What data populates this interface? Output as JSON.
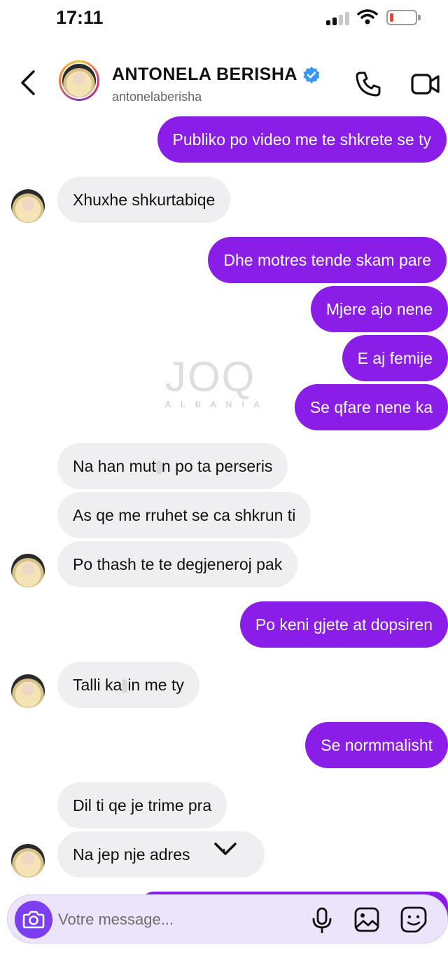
{
  "status_bar": {
    "time": "17:11"
  },
  "header": {
    "name": "ANTONELA BERISHA",
    "username": "antonelaberisha"
  },
  "messages": [
    {
      "type": "sent",
      "text": "Publiko po video me te shkrete se ty"
    },
    {
      "type": "received",
      "text": "Xhuxhe shkurtabiqe"
    },
    {
      "type": "sent",
      "text": "Dhe motres tende skam pare"
    },
    {
      "type": "sent",
      "text": "Mjere ajo nene"
    },
    {
      "type": "sent",
      "text": "E aj femije"
    },
    {
      "type": "sent",
      "text": "Se qfare nene ka"
    },
    {
      "type": "received",
      "text_a": "Na han mut",
      "text_b": "n po ta perseris"
    },
    {
      "type": "received",
      "text": "As qe me rruhet se ca shkrun ti"
    },
    {
      "type": "received",
      "text": "Po thash te te degjeneroj pak"
    },
    {
      "type": "sent",
      "text": "Po keni gjete at dopsiren"
    },
    {
      "type": "received",
      "text_a": "Talli ka",
      "text_b": "in me ty"
    },
    {
      "type": "sent",
      "text": "Se normmalisht"
    },
    {
      "type": "received",
      "text": "Dil ti qe je trime pra"
    },
    {
      "type": "received",
      "text_a": "Na jep nje adres",
      "text_b": "’"
    }
  ],
  "watermark": {
    "logo": "JOQ",
    "sub": "ALBANIA"
  },
  "composer": {
    "placeholder": "Votre message..."
  },
  "colors": {
    "sent_bubble": "#8a1ee8",
    "received_bubble": "#efeff1",
    "composer_bg": "#ebe4fb",
    "camera_button": "#7b3ef0"
  },
  "icons": [
    "back-arrow-icon",
    "verified-badge-icon",
    "phone-icon",
    "video-camera-icon",
    "camera-icon",
    "microphone-icon",
    "gallery-icon",
    "sticker-icon",
    "chevron-down-icon"
  ]
}
